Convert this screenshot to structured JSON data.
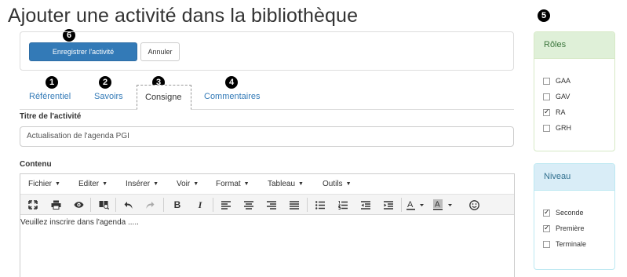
{
  "page": {
    "title": "Ajouter une activité dans la bibliothèque"
  },
  "markers": {
    "m1": "1",
    "m2": "2",
    "m3": "3",
    "m4": "4",
    "m5": "5",
    "m6": "6"
  },
  "actions": {
    "save_label": "Enregistrer l'activité",
    "cancel_label": "Annuler"
  },
  "tabs": [
    {
      "label": "Référentiel",
      "active": false
    },
    {
      "label": "Savoirs",
      "active": false
    },
    {
      "label": "Consigne",
      "active": true
    },
    {
      "label": "Commentaires",
      "active": false
    }
  ],
  "form": {
    "title_label": "Titre de l'activité",
    "title_value": "Actualisation de l'agenda PGI",
    "content_label": "Contenu"
  },
  "editor": {
    "menus": [
      "Fichier",
      "Editer",
      "Insérer",
      "Voir",
      "Format",
      "Tableau",
      "Outils"
    ],
    "toolbar_icons": [
      "fullscreen-icon",
      "print-icon",
      "preview-icon",
      "search-replace-icon",
      "undo-icon",
      "redo-icon",
      "bold-icon",
      "italic-icon",
      "align-left-icon",
      "align-center-icon",
      "align-right-icon",
      "justify-icon",
      "bullet-list-icon",
      "numbered-list-icon",
      "outdent-icon",
      "indent-icon",
      "text-color-icon",
      "background-color-icon",
      "emoticons-icon"
    ],
    "body_text": "Veuillez inscrire dans l'agenda ....."
  },
  "roles": {
    "title": "Rôles",
    "items": [
      {
        "label": "GAA",
        "checked": false
      },
      {
        "label": "GAV",
        "checked": false
      },
      {
        "label": "RA",
        "checked": true
      },
      {
        "label": "GRH",
        "checked": false
      }
    ]
  },
  "niveau": {
    "title": "Niveau",
    "items": [
      {
        "label": "Seconde",
        "checked": true
      },
      {
        "label": "Première",
        "checked": true
      },
      {
        "label": "Terminale",
        "checked": false
      }
    ]
  },
  "colors": {
    "primary": "#337ab7",
    "success_bg": "#dff0d8",
    "info_bg": "#d9edf7"
  }
}
